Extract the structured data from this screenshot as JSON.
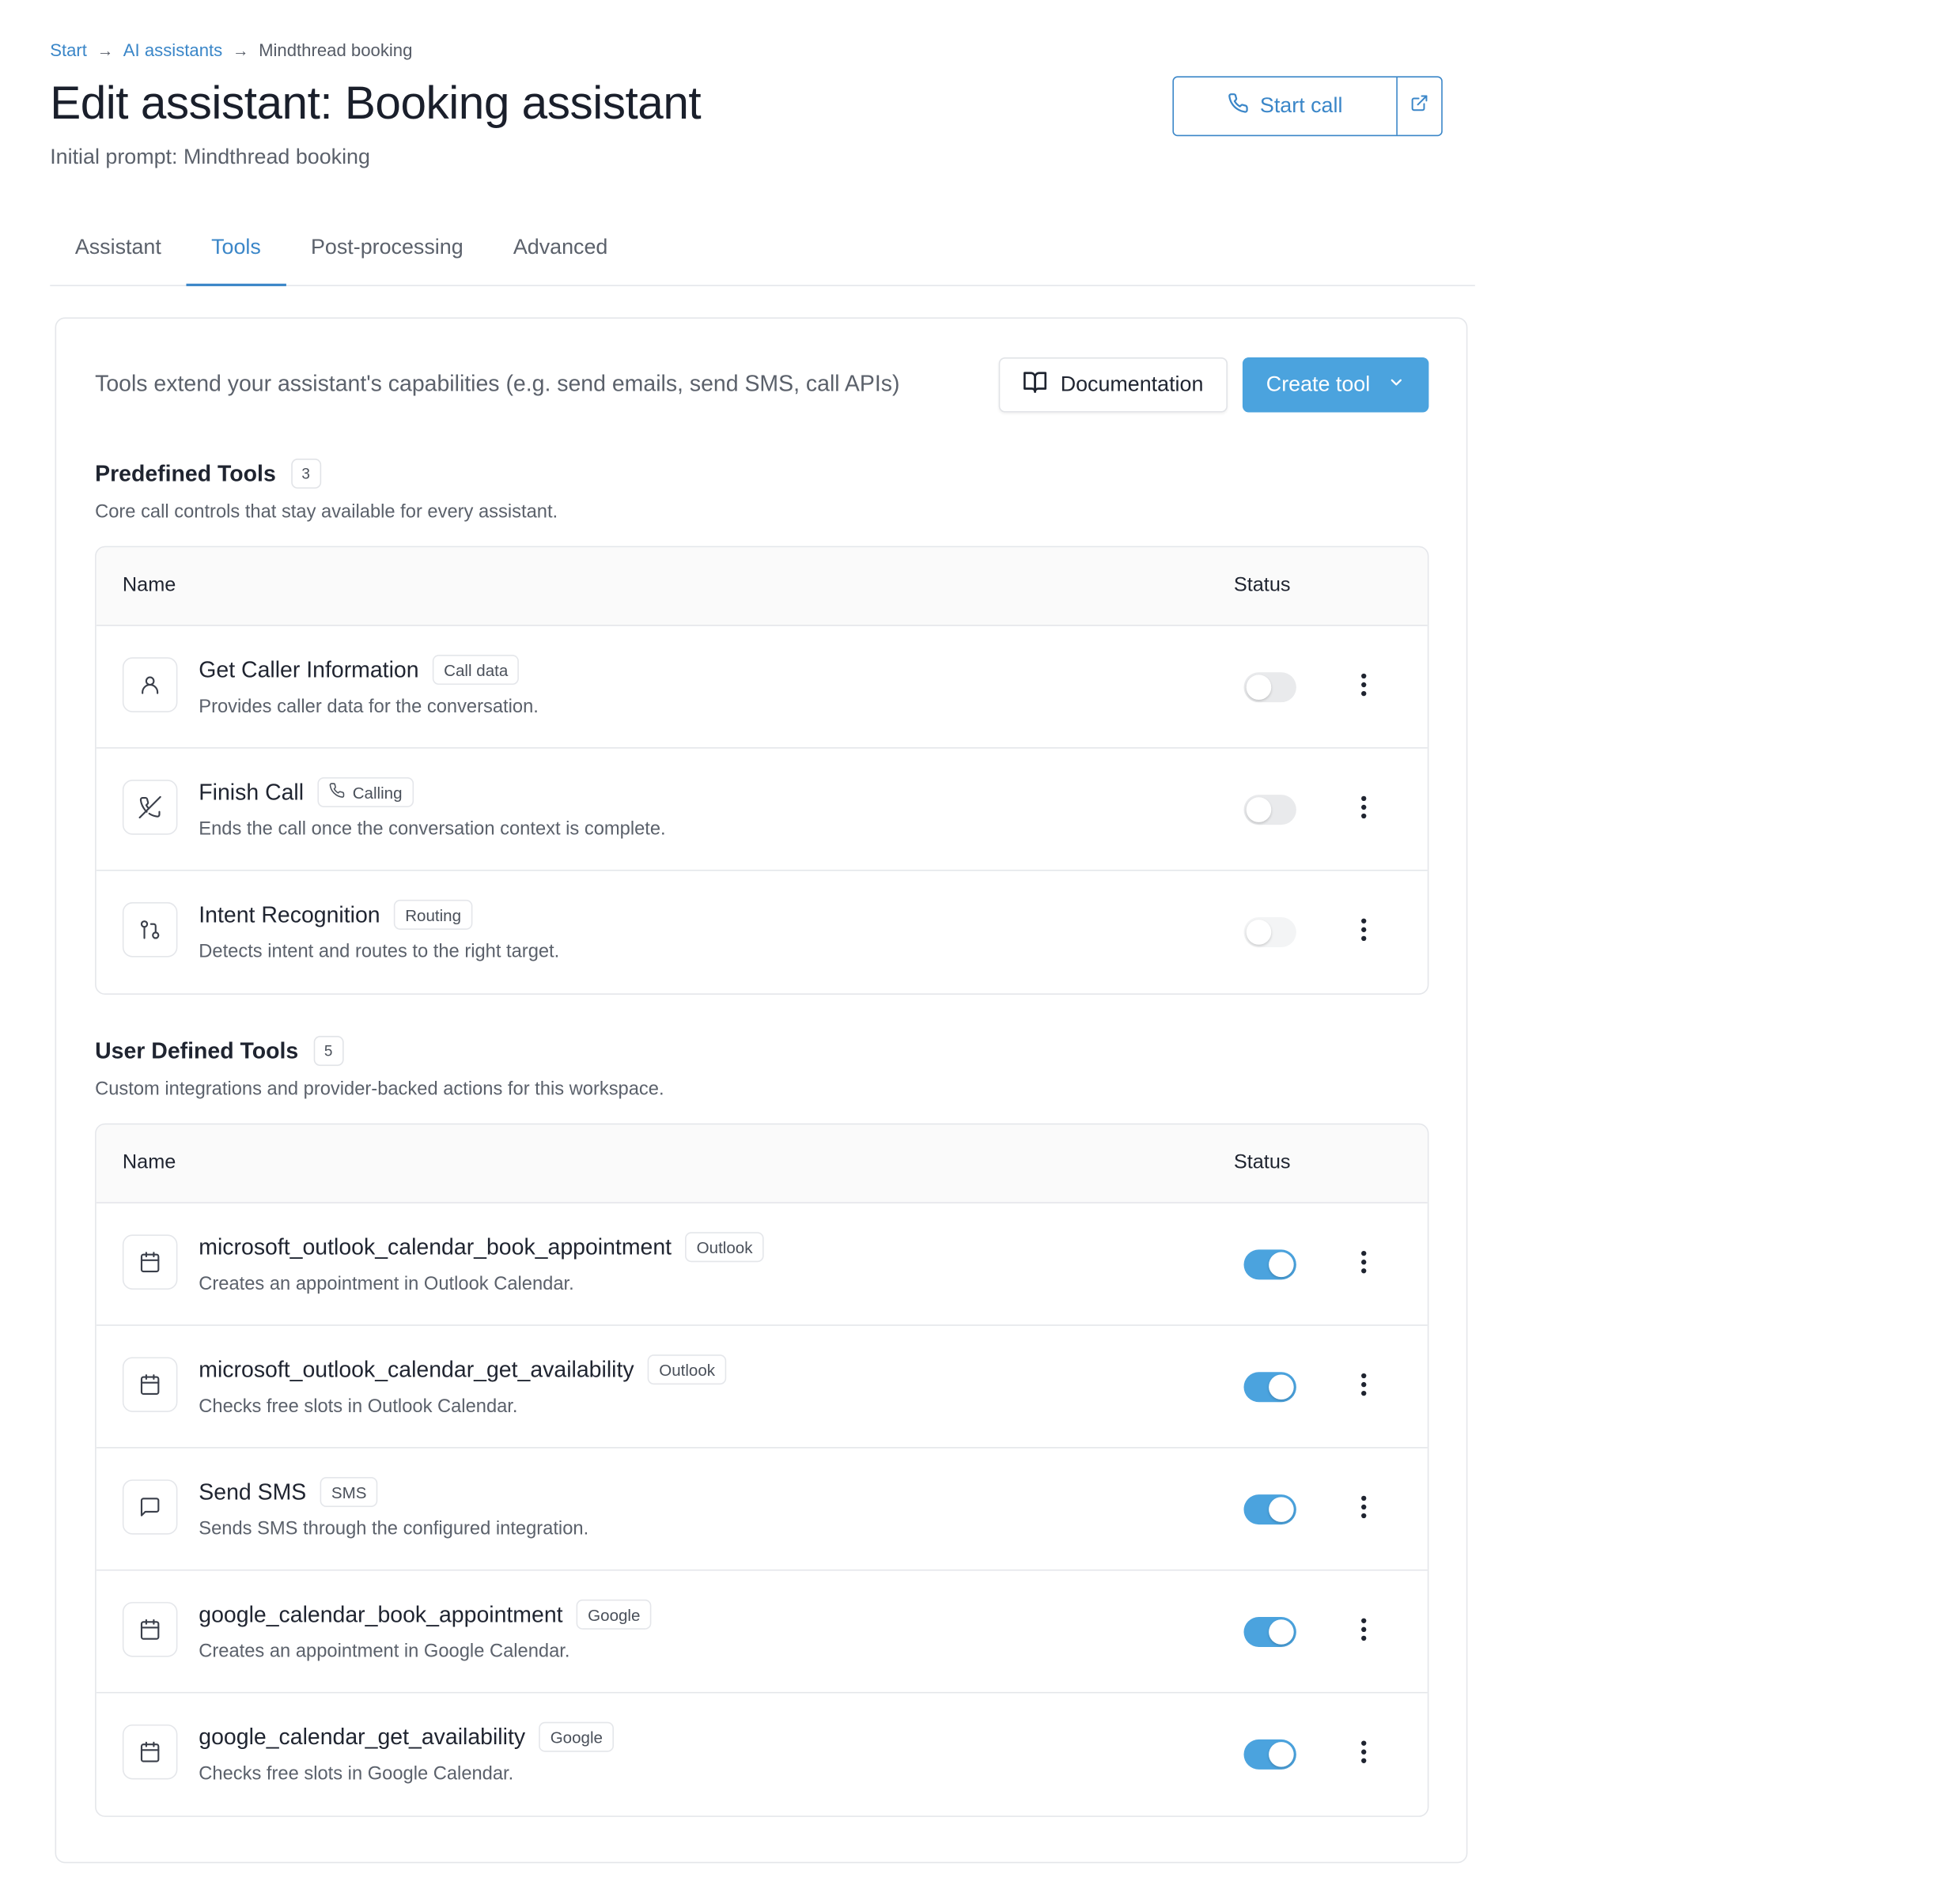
{
  "breadcrumb": [
    {
      "label": "Start",
      "link": true
    },
    {
      "label": "AI assistants",
      "link": true
    },
    {
      "label": "Mindthread booking",
      "link": false
    }
  ],
  "header": {
    "title": "Edit assistant: Booking assistant",
    "subtitle": "Initial prompt: Mindthread booking",
    "start_call_label": "Start call"
  },
  "tabs": [
    {
      "label": "Assistant",
      "active": false
    },
    {
      "label": "Tools",
      "active": true
    },
    {
      "label": "Post-processing",
      "active": false
    },
    {
      "label": "Advanced",
      "active": false
    }
  ],
  "panel": {
    "description": "Tools extend your assistant's capabilities (e.g. send emails, send SMS, call APIs)",
    "documentation_label": "Documentation",
    "create_tool_label": "Create tool"
  },
  "columns": {
    "name": "Name",
    "status": "Status"
  },
  "predefined": {
    "title": "Predefined Tools",
    "count": "3",
    "description": "Core call controls that stay available for every assistant.",
    "tools": [
      {
        "name": "Get Caller Information",
        "tag": "Call data",
        "tag_icon": "",
        "icon": "user-icon",
        "description": "Provides caller data for the conversation.",
        "enabled": false
      },
      {
        "name": "Finish Call",
        "tag": "Calling",
        "tag_icon": "phone-icon",
        "icon": "phone-off-icon",
        "description": "Ends the call once the conversation context is complete.",
        "enabled": false
      },
      {
        "name": "Intent Recognition",
        "tag": "Routing",
        "tag_icon": "",
        "icon": "git-pull-request-icon",
        "description": "Detects intent and routes to the right target.",
        "enabled": false
      }
    ]
  },
  "user_defined": {
    "title": "User Defined Tools",
    "count": "5",
    "description": "Custom integrations and provider-backed actions for this workspace.",
    "tools": [
      {
        "name": "microsoft_outlook_calendar_book_appointment",
        "tag": "Outlook",
        "tag_icon": "",
        "icon": "calendar-icon",
        "description": "Creates an appointment in Outlook Calendar.",
        "enabled": true
      },
      {
        "name": "microsoft_outlook_calendar_get_availability",
        "tag": "Outlook",
        "tag_icon": "",
        "icon": "calendar-icon",
        "description": "Checks free slots in Outlook Calendar.",
        "enabled": true
      },
      {
        "name": "Send SMS",
        "tag": "SMS",
        "tag_icon": "",
        "icon": "message-icon",
        "description": "Sends SMS through the configured integration.",
        "enabled": true
      },
      {
        "name": "google_calendar_book_appointment",
        "tag": "Google",
        "tag_icon": "",
        "icon": "calendar-icon",
        "description": "Creates an appointment in Google Calendar.",
        "enabled": true
      },
      {
        "name": "google_calendar_get_availability",
        "tag": "Google",
        "tag_icon": "",
        "icon": "calendar-icon",
        "description": "Checks free slots in Google Calendar.",
        "enabled": true
      }
    ]
  },
  "colors": {
    "accent": "#3a86c8",
    "button_primary": "#4ba3de",
    "toggle_on": "#4ba3de",
    "toggle_off": "#e9eaec"
  }
}
